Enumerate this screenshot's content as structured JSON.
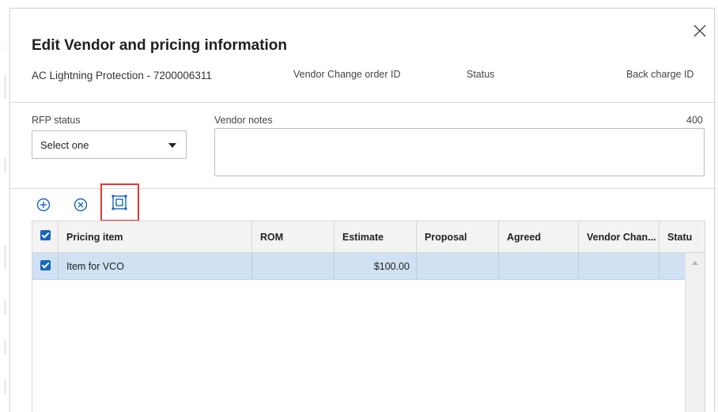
{
  "dialog": {
    "title": "Edit Vendor and pricing information",
    "subtitle": "AC Lightning Protection - 7200006311",
    "vco_label": "Vendor Change order ID",
    "status_label": "Status",
    "backcharge_label": "Back charge ID"
  },
  "form": {
    "rfp_label": "RFP status",
    "rfp_value": "Select one",
    "notes_label": "Vendor notes",
    "notes_limit": "400"
  },
  "toolbar": {
    "add_icon": "add-circle-icon",
    "remove_icon": "remove-circle-icon",
    "select_icon": "select-all-icon",
    "highlight_color": "#e53935",
    "icon_color": "#1565c0"
  },
  "grid": {
    "columns": [
      "Pricing item",
      "ROM",
      "Estimate",
      "Proposal",
      "Agreed",
      "Vendor Chan...",
      "Statu"
    ],
    "rows": [
      {
        "pricing_item": "Item for VCO",
        "rom": "",
        "estimate": "$100.00",
        "proposal": "",
        "agreed": "",
        "vendor_change": "",
        "status": ""
      }
    ],
    "selected_row_color": "#cfe1f3"
  }
}
